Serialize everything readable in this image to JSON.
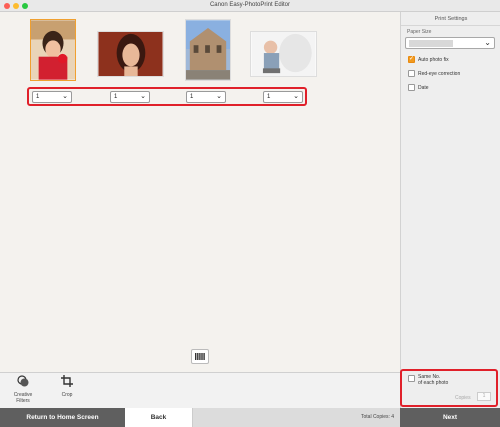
{
  "window": {
    "title": "Canon Easy-PhotoPrint Editor"
  },
  "photos": {
    "items": [
      {
        "copies": "1",
        "selected": true
      },
      {
        "copies": "1",
        "selected": false
      },
      {
        "copies": "1",
        "selected": false
      },
      {
        "copies": "1",
        "selected": false
      }
    ]
  },
  "side": {
    "header": "Print Settings",
    "paper_size_label": "Paper Size",
    "auto_fix_label": "Auto photo fix",
    "auto_fix_checked": true,
    "red_eye_label": "Red-eye correction",
    "red_eye_checked": false,
    "date_label": "Date",
    "date_checked": false,
    "same_no_label": "Same No.\nof each photo",
    "same_no_line1": "Same No.",
    "same_no_line2": "of each photo",
    "copies_label": "Copies",
    "copies_value": "1"
  },
  "toolbar": {
    "creative_filters_line1": "Creative",
    "creative_filters_line2": "Filters",
    "crop_label": "Crop"
  },
  "footer": {
    "home_label": "Return to Home Screen",
    "back_label": "Back",
    "total_copies": "Total Copies: 4",
    "next_label": "Next"
  },
  "colors": {
    "accent_orange": "#f29a1f",
    "highlight_red": "#e0202a",
    "footer_dark": "#5f5f5f"
  },
  "icons": [
    "creative-filters-icon",
    "crop-icon",
    "filmstrip-icon",
    "chevron-down-icon",
    "checkmark-icon"
  ]
}
